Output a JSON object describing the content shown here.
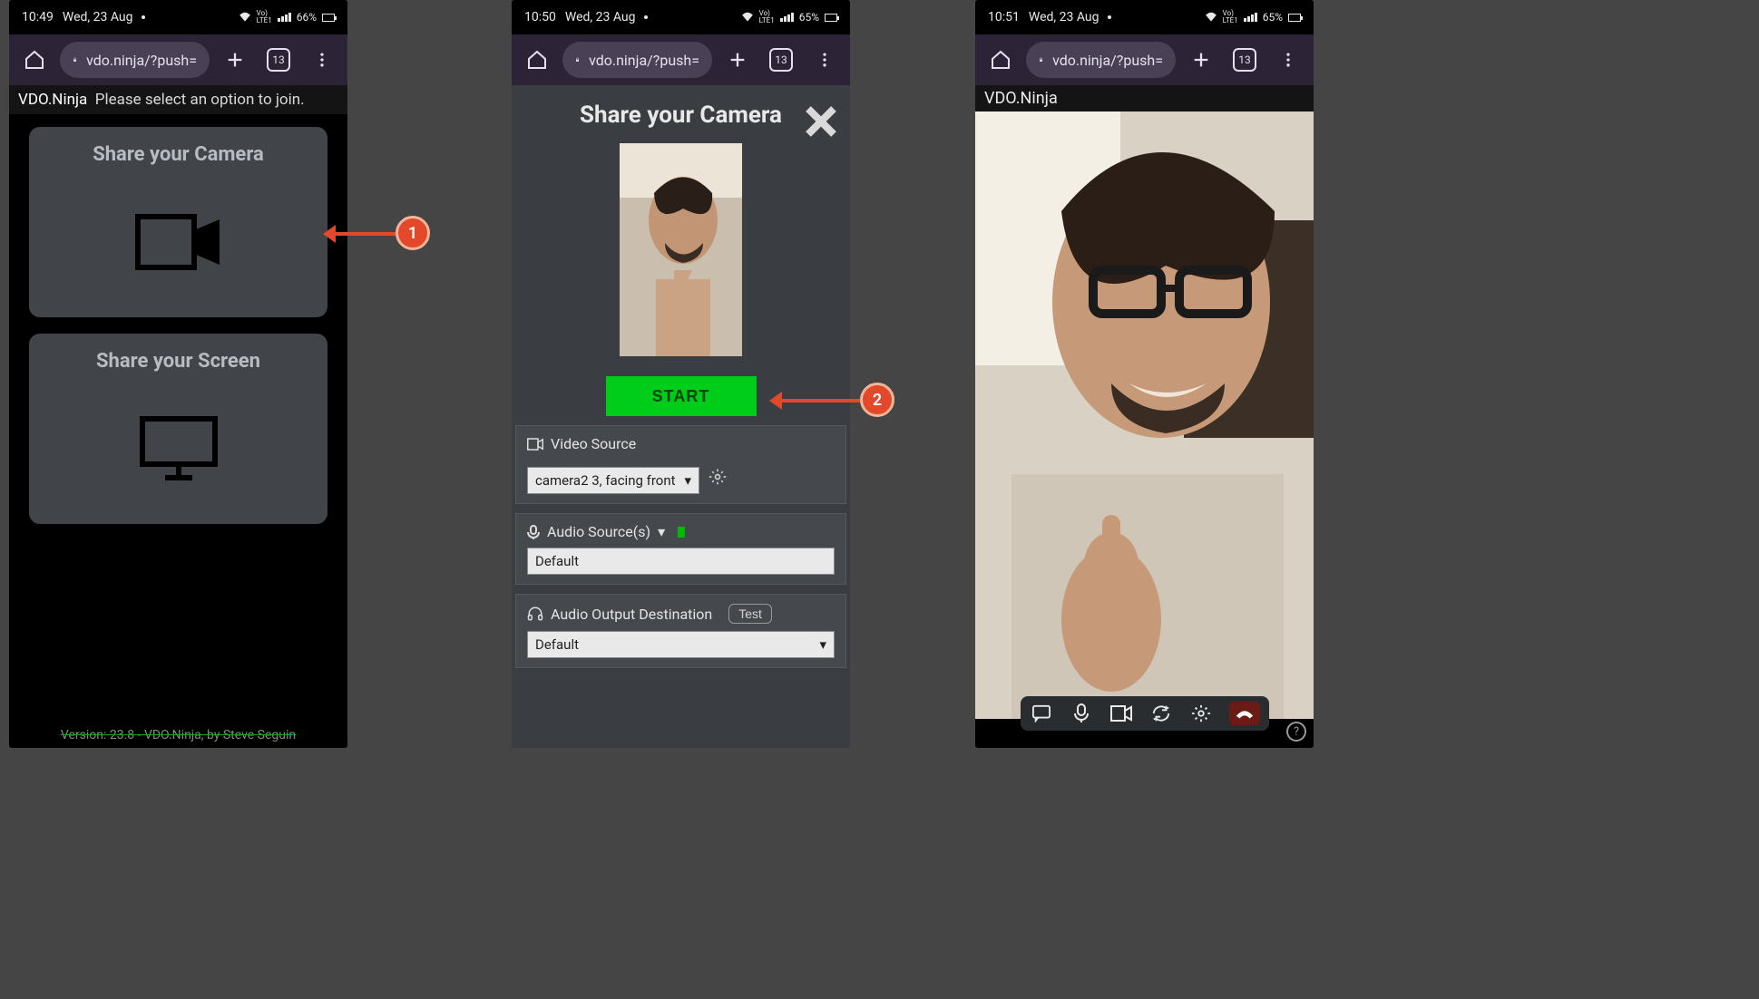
{
  "phones": {
    "one": {
      "status": {
        "time": "10:49",
        "date": "Wed, 23 Aug",
        "battery": "66%"
      },
      "url": "vdo.ninja/?push=",
      "tabs": "13",
      "header_app": "VDO.Ninja",
      "header_msg": "Please select an option to join.",
      "card_camera": "Share your Camera",
      "card_screen": "Share your Screen",
      "version": "Version: 23.8 - VDO.Ninja, by Steve Seguin"
    },
    "two": {
      "status": {
        "time": "10:50",
        "date": "Wed, 23 Aug",
        "battery": "65%"
      },
      "url": "vdo.ninja/?push=",
      "tabs": "13",
      "title": "Share your Camera",
      "start": "START",
      "videoSourceLabel": "Video Source",
      "videoSourceValue": "camera2 3, facing front",
      "audioSourceLabel": "Audio Source(s)",
      "audioSourceValue": "Default",
      "audioOutputLabel": "Audio Output Destination",
      "audioOutputTest": "Test",
      "audioOutputValue": "Default"
    },
    "three": {
      "status": {
        "time": "10:51",
        "date": "Wed, 23 Aug",
        "battery": "65%"
      },
      "url": "vdo.ninja/?push=",
      "tabs": "13",
      "header_app": "VDO.Ninja"
    }
  },
  "annotations": {
    "step1": "1",
    "step2": "2"
  }
}
